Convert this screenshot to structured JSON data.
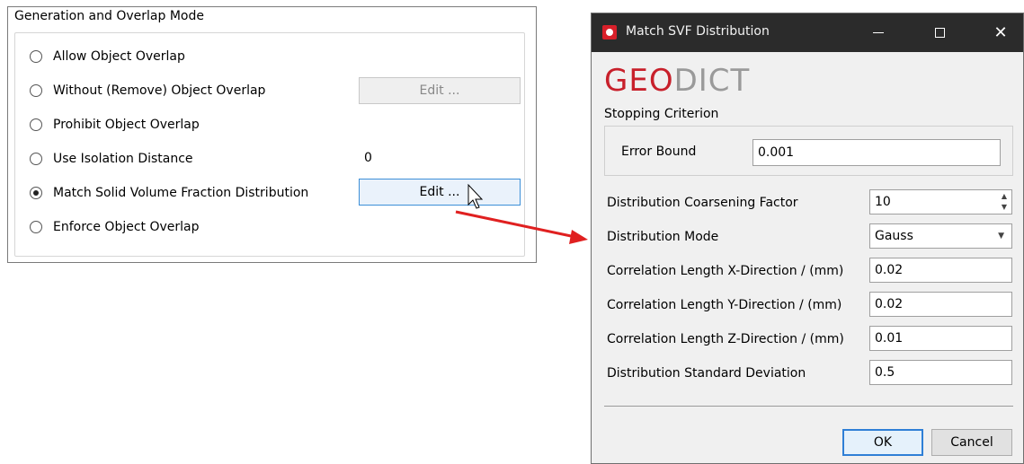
{
  "left_panel": {
    "title": "Generation and Overlap Mode",
    "options": [
      {
        "label": "Allow Object Overlap",
        "checked": false
      },
      {
        "label": "Without (Remove) Object Overlap",
        "checked": false
      },
      {
        "label": "Prohibit Object Overlap",
        "checked": false
      },
      {
        "label": "Use Isolation Distance",
        "checked": false
      },
      {
        "label": "Match Solid Volume Fraction Distribution",
        "checked": true
      },
      {
        "label": "Enforce Object Overlap",
        "checked": false
      }
    ],
    "edit_button_disabled_label": "Edit ...",
    "edit_button_active_label": "Edit ...",
    "isolation_distance_value": "0"
  },
  "dialog": {
    "title": "Match SVF Distribution",
    "logo_part1": "GEO",
    "logo_part2": "DICT",
    "stopping_criterion_label": "Stopping Criterion",
    "error_bound_label": "Error Bound",
    "error_bound_value": "0.001",
    "fields": [
      {
        "label": "Distribution Coarsening Factor",
        "value": "10",
        "kind": "spinbox"
      },
      {
        "label": "Distribution Mode",
        "value": "Gauss",
        "kind": "combobox"
      },
      {
        "label": "Correlation Length X-Direction / (mm)",
        "value": "0.02",
        "kind": "text"
      },
      {
        "label": "Correlation Length Y-Direction / (mm)",
        "value": "0.02",
        "kind": "text"
      },
      {
        "label": "Correlation Length Z-Direction / (mm)",
        "value": "0.01",
        "kind": "text"
      },
      {
        "label": "Distribution Standard Deviation",
        "value": "0.5",
        "kind": "text"
      }
    ],
    "ok_label": "OK",
    "cancel_label": "Cancel",
    "titlebar_color": "#2b2b2b",
    "logo_red": "#c8202b"
  },
  "annotation": {
    "arrow_color": "#e02020",
    "arrow_icon": "red-arrow-icon"
  }
}
